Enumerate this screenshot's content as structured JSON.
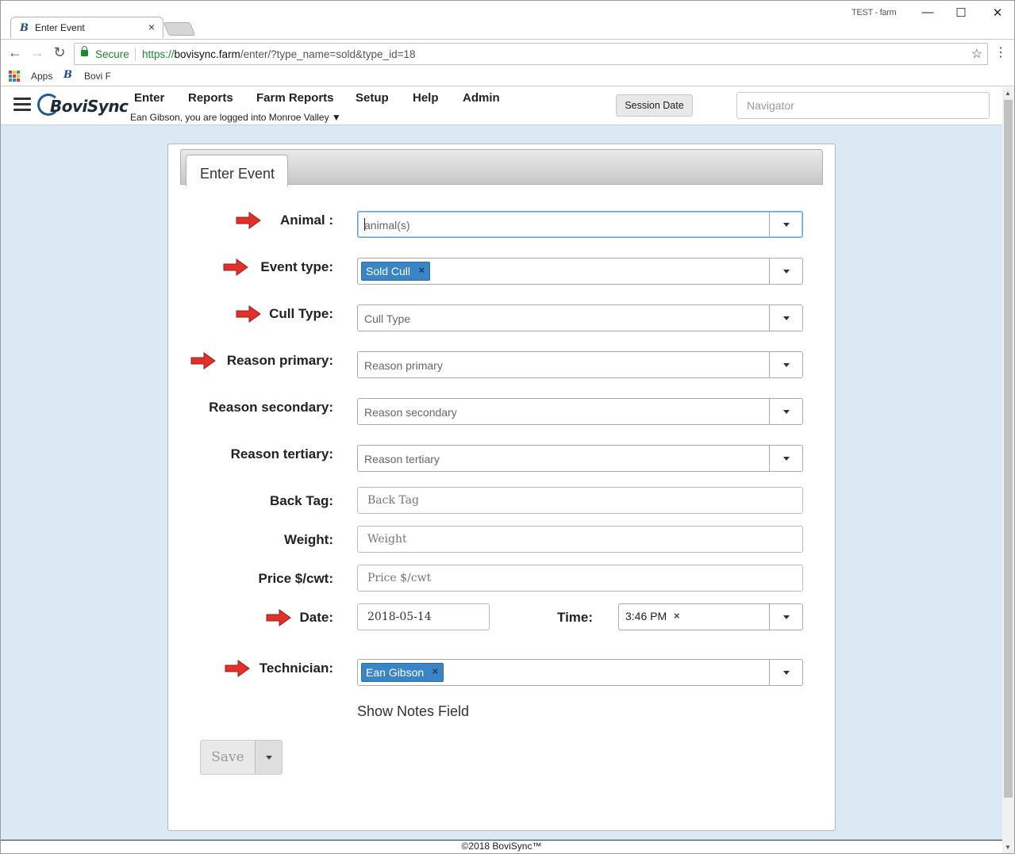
{
  "browser": {
    "tab_title": "Enter Event",
    "tab_close": "×",
    "profile": "TEST - farm",
    "minimize": "—",
    "maximize": "☐",
    "close": "✕",
    "secure_label": "Secure",
    "url_scheme": "https://",
    "url_host": "bovisync.farm",
    "url_path": "/enter/?type_name=sold&type_id=18",
    "bookmarks": [
      "Apps",
      "Bovi F"
    ]
  },
  "app": {
    "logo_text": "BoviSync",
    "nav": [
      "Enter",
      "Reports",
      "Farm Reports",
      "Setup",
      "Help",
      "Admin"
    ],
    "logged_in": "Ean Gibson, you are logged into Monroe Valley ▼",
    "session_date": "Session Date",
    "navigator_placeholder": "Navigator"
  },
  "form": {
    "tab_label": "Enter Event",
    "animal_label": "Animal :",
    "animal_placeholder": "animal(s)",
    "event_type_label": "Event type:",
    "event_type_value": "Sold Cull",
    "cull_type_label": "Cull Type:",
    "cull_type_placeholder": "Cull Type",
    "reason_primary_label": "Reason primary:",
    "reason_primary_placeholder": "Reason primary",
    "reason_secondary_label": "Reason secondary:",
    "reason_secondary_placeholder": "Reason secondary",
    "reason_tertiary_label": "Reason tertiary:",
    "reason_tertiary_placeholder": "Reason tertiary",
    "back_tag_label": "Back Tag:",
    "back_tag_placeholder": "Back Tag",
    "weight_label": "Weight:",
    "weight_placeholder": "Weight",
    "price_label": "Price $/cwt:",
    "price_placeholder": "Price $/cwt",
    "date_label": "Date:",
    "date_value": "2018-05-14",
    "time_label": "Time:",
    "time_value": "3:46 PM",
    "technician_label": "Technician:",
    "technician_value": "Ean Gibson",
    "chip_remove": "×",
    "show_notes": "Show Notes Field",
    "save": "Save"
  },
  "footer": "©2018 BoviSync™",
  "colors": {
    "page_bg": "#dbe9f5",
    "chip": "#3a85c6",
    "arrow": "#e0312b",
    "secure": "#1a8a2e"
  }
}
